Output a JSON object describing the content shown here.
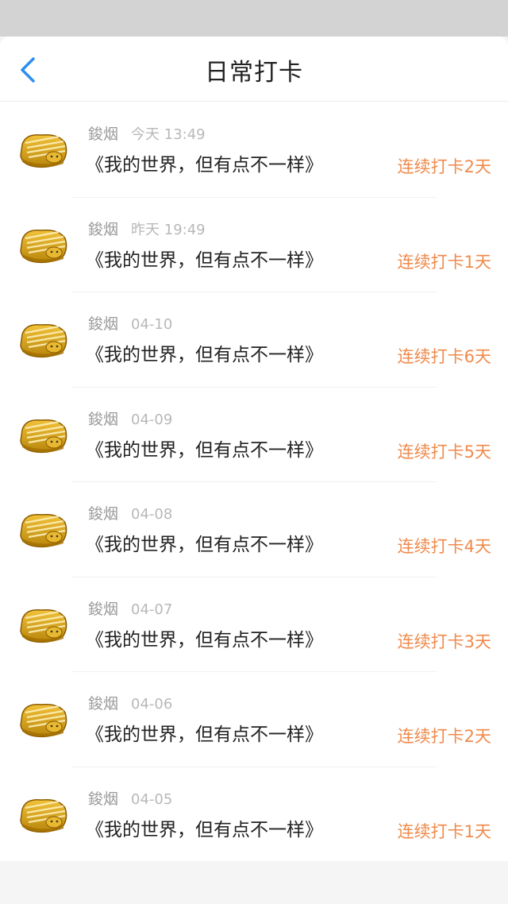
{
  "nav": {
    "title": "日常打卡"
  },
  "colors": {
    "status_bar": "#d3d3d3",
    "back_accent": "#2d8ef2",
    "streak_text": "#f08a4b"
  },
  "icons": {
    "back": "chevron-left-icon",
    "avatar": "bread-slice-avatar"
  },
  "checkins": [
    {
      "user": "鋑烟",
      "time": "今天 13:49",
      "content": "《我的世界，但有点不一样》",
      "streak": "连续打卡2天"
    },
    {
      "user": "鋑烟",
      "time": "昨天 19:49",
      "content": "《我的世界，但有点不一样》",
      "streak": "连续打卡1天"
    },
    {
      "user": "鋑烟",
      "time": "04-10",
      "content": "《我的世界，但有点不一样》",
      "streak": "连续打卡6天"
    },
    {
      "user": "鋑烟",
      "time": "04-09",
      "content": "《我的世界，但有点不一样》",
      "streak": "连续打卡5天"
    },
    {
      "user": "鋑烟",
      "time": "04-08",
      "content": "《我的世界，但有点不一样》",
      "streak": "连续打卡4天"
    },
    {
      "user": "鋑烟",
      "time": "04-07",
      "content": "《我的世界，但有点不一样》",
      "streak": "连续打卡3天"
    },
    {
      "user": "鋑烟",
      "time": "04-06",
      "content": "《我的世界，但有点不一样》",
      "streak": "连续打卡2天"
    },
    {
      "user": "鋑烟",
      "time": "04-05",
      "content": "《我的世界，但有点不一样》",
      "streak": "连续打卡1天"
    }
  ]
}
